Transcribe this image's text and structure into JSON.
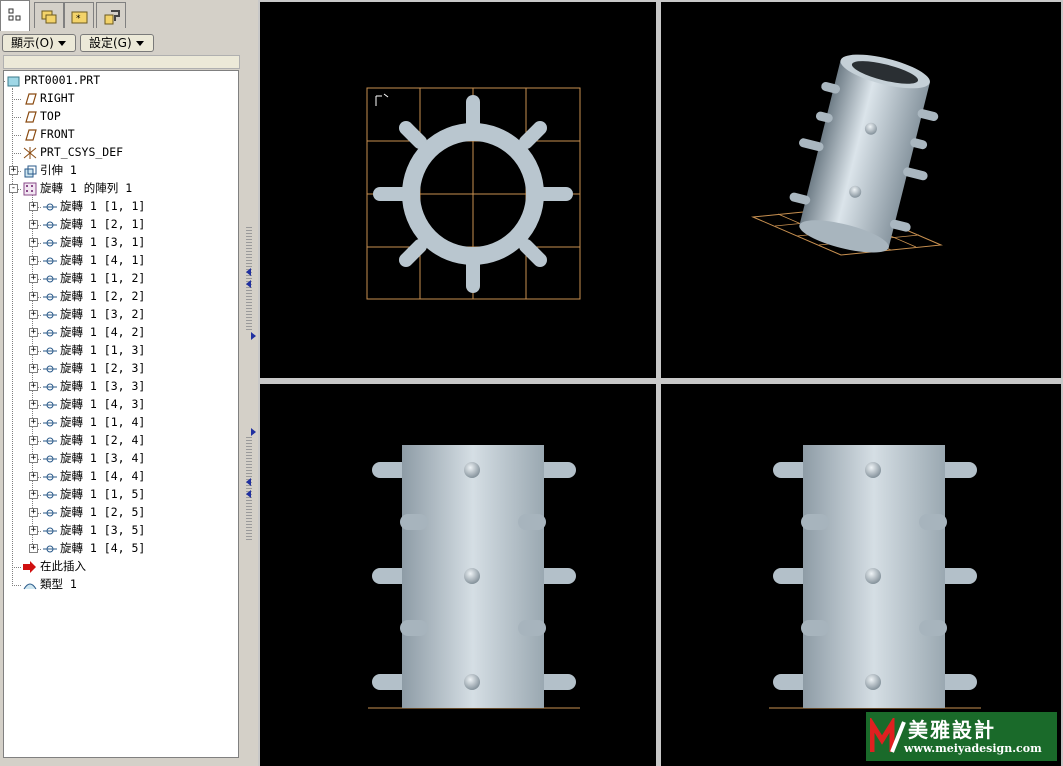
{
  "toolbar": {
    "display_label": "顯示(O)",
    "settings_label": "設定(G)"
  },
  "tabs": [
    {
      "icon": "model-tree-icon",
      "active": true
    },
    {
      "icon": "folder-browser-icon",
      "active": false
    },
    {
      "icon": "favorites-folder-icon",
      "active": false
    },
    {
      "icon": "connections-icon",
      "active": false
    }
  ],
  "tree": {
    "root": "PRT0001.PRT",
    "datums": [
      "RIGHT",
      "TOP",
      "FRONT",
      "PRT_CSYS_DEF"
    ],
    "extrude": "引伸 1",
    "pattern": "旋轉 1 的陣列 1",
    "pattern_members": [
      "旋轉 1 [1, 1]",
      "旋轉 1 [2, 1]",
      "旋轉 1 [3, 1]",
      "旋轉 1 [4, 1]",
      "旋轉 1 [1, 2]",
      "旋轉 1 [2, 2]",
      "旋轉 1 [3, 2]",
      "旋轉 1 [4, 2]",
      "旋轉 1 [1, 3]",
      "旋轉 1 [2, 3]",
      "旋轉 1 [3, 3]",
      "旋轉 1 [4, 3]",
      "旋轉 1 [1, 4]",
      "旋轉 1 [2, 4]",
      "旋轉 1 [3, 4]",
      "旋轉 1 [4, 4]",
      "旋轉 1 [1, 5]",
      "旋轉 1 [2, 5]",
      "旋轉 1 [3, 5]",
      "旋轉 1 [4, 5]"
    ],
    "insert_here": "在此插入",
    "last_item": "類型 1"
  },
  "viewports": [
    "top-view",
    "isometric-view",
    "front-view",
    "side-view"
  ],
  "watermark": {
    "brand": "美雅設計",
    "url": "www.meiyadesign.com"
  },
  "colors": {
    "viewport_bg": "#000000",
    "model": "#b9c6cf",
    "datum_grid": "#c89050",
    "panel": "#d4d0c8",
    "insert_arrow": "#d01010"
  }
}
